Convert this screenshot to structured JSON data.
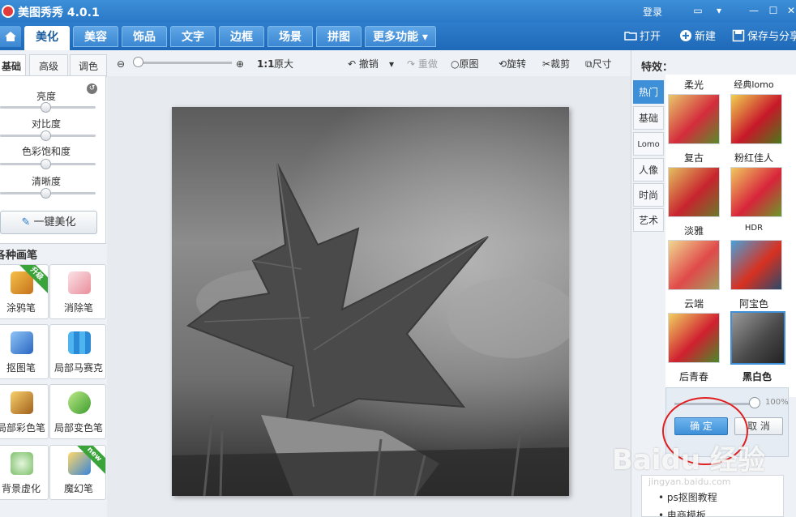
{
  "app": {
    "title": "美图秀秀 4.0.1",
    "login": "登录"
  },
  "nav": {
    "tabs": [
      "美化",
      "美容",
      "饰品",
      "文字",
      "边框",
      "场景",
      "拼图",
      "更多功能"
    ],
    "open": "打开",
    "new": "新建",
    "save_share": "保存与分享"
  },
  "left": {
    "tabs": [
      "基础",
      "高级",
      "调色"
    ],
    "sliders": [
      {
        "label": "亮度",
        "value": 0.5
      },
      {
        "label": "对比度",
        "value": 0.5
      },
      {
        "label": "色彩饱和度",
        "value": 0.5
      },
      {
        "label": "清晰度",
        "value": 0.5
      }
    ],
    "one_click": "一键美化",
    "brush_title": "各种画笔",
    "brushes": [
      {
        "label": "涂鸦笔",
        "badge": "升级"
      },
      {
        "label": "消除笔",
        "badge": ""
      },
      {
        "label": "抠图笔",
        "badge": ""
      },
      {
        "label": "局部马赛克",
        "badge": ""
      },
      {
        "label": "局部彩色笔",
        "badge": ""
      },
      {
        "label": "局部变色笔",
        "badge": ""
      },
      {
        "label": "背景虚化",
        "badge": ""
      },
      {
        "label": "魔幻笔",
        "badge": "new"
      }
    ]
  },
  "toolbar": {
    "original_size_ratio": "1:1",
    "original_size": "原大",
    "undo": "撤销",
    "redo": "重做",
    "original": "原图",
    "rotate": "旋转",
    "crop": "裁剪",
    "size": "尺寸"
  },
  "right": {
    "title": "特效：",
    "categories": [
      "热门",
      "基础",
      "Lomo",
      "人像",
      "时尚",
      "艺术"
    ],
    "effects": [
      {
        "name": "柔光"
      },
      {
        "name": "经典lomo"
      },
      {
        "name": "复古"
      },
      {
        "name": "粉红佳人"
      },
      {
        "name": "淡雅"
      },
      {
        "name": "HDR"
      },
      {
        "name": "云端"
      },
      {
        "name": "阿宝色"
      },
      {
        "name": "后青春"
      },
      {
        "name": "黑白色"
      }
    ],
    "selected_effect": "黑白色",
    "opacity_value": "100%",
    "opacity_fraction": 1.0,
    "confirm": "确 定",
    "cancel": "取 消",
    "dropdown_items": [
      "ps抠图教程",
      "电商模板"
    ],
    "watermark": "Baidu 经验",
    "watermark_url": "jingyan.baidu.com"
  }
}
